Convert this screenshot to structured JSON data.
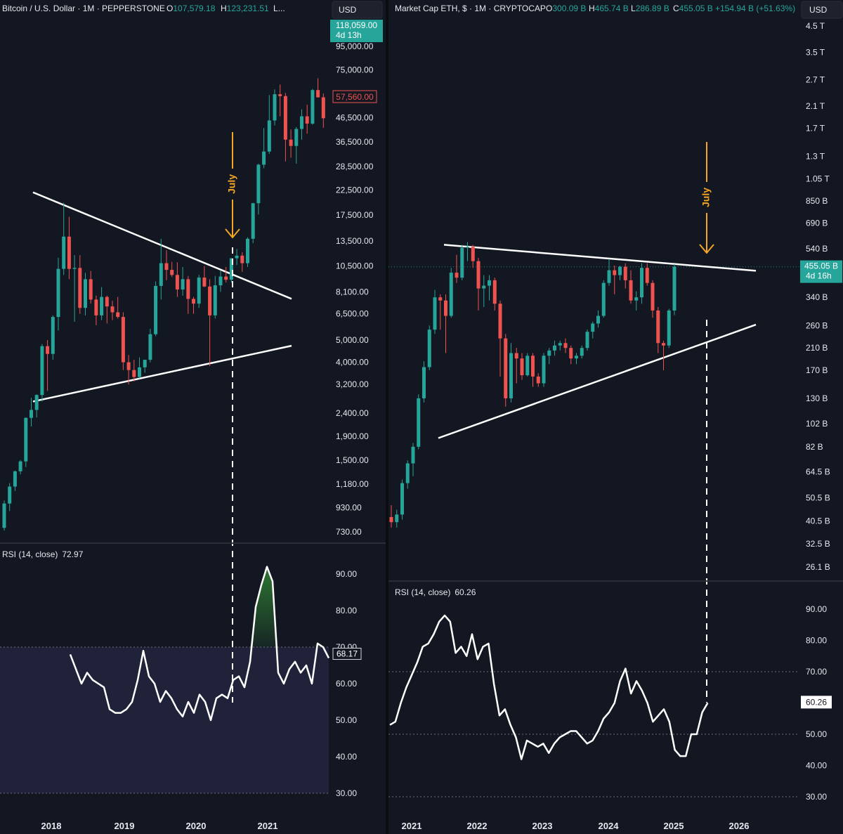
{
  "colors": {
    "background": "#131722",
    "up": "#26a69a",
    "down": "#ef5350",
    "trend_line": "#ffffff",
    "annotation": "#f5a623",
    "rsi_line": "#ffffff",
    "rsi_band": "#2a2c4d",
    "rsi_overbought_fill": "#2e7d32",
    "text": "#e6e8ef",
    "muted": "#8a8f9c"
  },
  "left": {
    "title": "Bitcoin / U.S. Dollar · 1M · PEPPERSTONE",
    "ohlc": [
      {
        "k": "O",
        "v": "107,579.18"
      },
      {
        "k": "H",
        "v": "123,231.51"
      },
      {
        "k": "L",
        "v": "..."
      }
    ],
    "currency_button": "USD",
    "price_axis_labels": [
      "95,000.00",
      "75,000.00",
      "46,500.00",
      "36,500.00",
      "28,500.00",
      "22,500.00",
      "17,500.00",
      "13,500.00",
      "10,500.00",
      "8,100.00",
      "6,500.00",
      "5,000.00",
      "4,000.00",
      "3,200.00",
      "2,400.00",
      "1,900.00",
      "1,500.00",
      "1,180.00",
      "930.00",
      "730.00"
    ],
    "last_price_tag": {
      "price": "118,059.00",
      "countdown": "4d 13h"
    },
    "marker_tag": "57,560.00",
    "annotation": "July",
    "rsi": {
      "title": "RSI (14, close)",
      "value": "72.97",
      "tag": "68.17",
      "axis_labels": [
        "90.00",
        "80.00",
        "70.00",
        "60.00",
        "50.00",
        "40.00",
        "30.00"
      ]
    },
    "x_axis_labels": [
      "2018",
      "2019",
      "2020",
      "2021"
    ]
  },
  "right": {
    "title": "Market Cap ETH, $ · 1M · CRYPTOCAP",
    "ohlc": [
      {
        "k": "O",
        "v": "300.09 B"
      },
      {
        "k": "H",
        "v": "465.74 B"
      },
      {
        "k": "L",
        "v": "286.89 B"
      },
      {
        "k": "C",
        "v": "455.05 B"
      }
    ],
    "change": "+154.94 B (+51.63%)",
    "currency_button": "USD",
    "price_axis_labels": [
      "4.5 T",
      "3.5 T",
      "2.7 T",
      "2.1 T",
      "1.7 T",
      "1.3 T",
      "1.05 T",
      "850 B",
      "690 B",
      "540 B",
      "340 B",
      "260 B",
      "210 B",
      "170 B",
      "130 B",
      "102 B",
      "82 B",
      "64.5 B",
      "50.5 B",
      "40.5 B",
      "32.5 B",
      "26.1 B"
    ],
    "last_price_tag": {
      "price": "455.05 B",
      "countdown": "4d 16h"
    },
    "annotation": "July",
    "rsi": {
      "title": "RSI (14, close)",
      "value": "60.26",
      "tag": "60.26",
      "axis_labels": [
        "90.00",
        "80.00",
        "70.00",
        "60.00",
        "50.00",
        "40.00",
        "30.00"
      ]
    },
    "x_axis_labels": [
      "2021",
      "2022",
      "2023",
      "2024",
      "2025",
      "2026"
    ]
  },
  "chart_data": [
    {
      "type": "candlestick",
      "title": "Bitcoin / U.S. Dollar · 1M · PEPPERSTONE",
      "y_scale": "log",
      "ylim": [
        650,
        125000
      ],
      "x_ticks": [
        "2018",
        "2019",
        "2020",
        "2021"
      ],
      "candles": [
        {
          "o": 760,
          "h": 1000,
          "l": 740,
          "c": 970
        },
        {
          "o": 970,
          "h": 1190,
          "l": 900,
          "c": 1150
        },
        {
          "o": 1150,
          "h": 1350,
          "l": 1100,
          "c": 1340
        },
        {
          "o": 1340,
          "h": 1500,
          "l": 1300,
          "c": 1480
        },
        {
          "o": 1480,
          "h": 2300,
          "l": 1400,
          "c": 2290
        },
        {
          "o": 2290,
          "h": 2800,
          "l": 2100,
          "c": 2480
        },
        {
          "o": 2480,
          "h": 2900,
          "l": 2300,
          "c": 2880
        },
        {
          "o": 2880,
          "h": 4800,
          "l": 2700,
          "c": 4700
        },
        {
          "o": 4700,
          "h": 5000,
          "l": 3000,
          "c": 4350
        },
        {
          "o": 4350,
          "h": 6400,
          "l": 4100,
          "c": 6300
        },
        {
          "o": 6300,
          "h": 11400,
          "l": 5500,
          "c": 10200
        },
        {
          "o": 10200,
          "h": 19800,
          "l": 9600,
          "c": 14100
        },
        {
          "o": 14100,
          "h": 17200,
          "l": 9200,
          "c": 10200
        },
        {
          "o": 10200,
          "h": 11700,
          "l": 6000,
          "c": 10300
        },
        {
          "o": 10300,
          "h": 11700,
          "l": 6500,
          "c": 6900
        },
        {
          "o": 6900,
          "h": 9800,
          "l": 6400,
          "c": 9200
        },
        {
          "o": 9200,
          "h": 10000,
          "l": 7200,
          "c": 7500
        },
        {
          "o": 7500,
          "h": 7800,
          "l": 5800,
          "c": 6400
        },
        {
          "o": 6400,
          "h": 8500,
          "l": 6100,
          "c": 7700
        },
        {
          "o": 7700,
          "h": 7800,
          "l": 5900,
          "c": 7000
        },
        {
          "o": 7000,
          "h": 7400,
          "l": 6100,
          "c": 6600
        },
        {
          "o": 6600,
          "h": 7700,
          "l": 6200,
          "c": 6300
        },
        {
          "o": 6300,
          "h": 6600,
          "l": 3700,
          "c": 4000
        },
        {
          "o": 4000,
          "h": 4300,
          "l": 3200,
          "c": 3700
        },
        {
          "o": 3700,
          "h": 4100,
          "l": 3300,
          "c": 3450
        },
        {
          "o": 3450,
          "h": 4200,
          "l": 3400,
          "c": 3800
        },
        {
          "o": 3800,
          "h": 4100,
          "l": 3600,
          "c": 4100
        },
        {
          "o": 4100,
          "h": 5600,
          "l": 4000,
          "c": 5300
        },
        {
          "o": 5300,
          "h": 9000,
          "l": 5200,
          "c": 8600
        },
        {
          "o": 8600,
          "h": 13800,
          "l": 7500,
          "c": 10800
        },
        {
          "o": 10800,
          "h": 12300,
          "l": 9100,
          "c": 10100
        },
        {
          "o": 10100,
          "h": 10950,
          "l": 9400,
          "c": 9600
        },
        {
          "o": 9600,
          "h": 10900,
          "l": 7700,
          "c": 8300
        },
        {
          "o": 8300,
          "h": 10400,
          "l": 7800,
          "c": 9200
        },
        {
          "o": 9200,
          "h": 9500,
          "l": 6500,
          "c": 7550
        },
        {
          "o": 7550,
          "h": 7700,
          "l": 6500,
          "c": 7200
        },
        {
          "o": 7200,
          "h": 9600,
          "l": 6900,
          "c": 9350
        },
        {
          "o": 9350,
          "h": 10500,
          "l": 8500,
          "c": 8550
        },
        {
          "o": 8550,
          "h": 9200,
          "l": 3850,
          "c": 6400
        },
        {
          "o": 6400,
          "h": 9500,
          "l": 6200,
          "c": 8650
        },
        {
          "o": 8650,
          "h": 10000,
          "l": 8100,
          "c": 9450
        },
        {
          "o": 9450,
          "h": 10400,
          "l": 8900,
          "c": 9150
        },
        {
          "o": 9150,
          "h": 9850,
          "l": 8900,
          "c": 11350
        },
        {
          "o": 11350,
          "h": 12450,
          "l": 10600,
          "c": 11650
        },
        {
          "o": 11650,
          "h": 12050,
          "l": 9900,
          "c": 10800
        },
        {
          "o": 10800,
          "h": 14000,
          "l": 10400,
          "c": 13800
        },
        {
          "o": 13800,
          "h": 19800,
          "l": 13200,
          "c": 19700
        },
        {
          "o": 19700,
          "h": 29300,
          "l": 17600,
          "c": 29000
        },
        {
          "o": 29000,
          "h": 41900,
          "l": 28000,
          "c": 33100
        },
        {
          "o": 33100,
          "h": 58300,
          "l": 32300,
          "c": 45200
        },
        {
          "o": 45200,
          "h": 61700,
          "l": 43000,
          "c": 58800
        },
        {
          "o": 58800,
          "h": 64800,
          "l": 47100,
          "c": 57700
        },
        {
          "o": 57700,
          "h": 59500,
          "l": 30000,
          "c": 37300
        },
        {
          "o": 37300,
          "h": 41300,
          "l": 31100,
          "c": 35000
        },
        {
          "o": 35000,
          "h": 42300,
          "l": 29300,
          "c": 41500
        },
        {
          "o": 41500,
          "h": 50500,
          "l": 37300,
          "c": 47100
        },
        {
          "o": 47100,
          "h": 52900,
          "l": 39600,
          "c": 43800
        },
        {
          "o": 43800,
          "h": 62000,
          "l": 43300,
          "c": 61300
        },
        {
          "o": 61300,
          "h": 69000,
          "l": 56800,
          "c": 57000
        },
        {
          "o": 57000,
          "h": 59200,
          "l": 42000,
          "c": 46200
        }
      ],
      "trendlines": [
        {
          "from": {
            "index": 10,
            "price": 19800
          },
          "to": {
            "index": 50,
            "price": 8100
          }
        },
        {
          "from": {
            "index": 10,
            "price": 2850
          },
          "to": {
            "index": 50,
            "price": 4550
          }
        }
      ],
      "annotation": {
        "text": "July",
        "index": 42
      },
      "rsi": {
        "name": "RSI (14, close)",
        "ylim": [
          30,
          90
        ],
        "band": [
          30,
          70
        ],
        "values": [
          68,
          64,
          60,
          63,
          61,
          60,
          59,
          53,
          52,
          52,
          53,
          55,
          61,
          69,
          62,
          60,
          55,
          58,
          56,
          53,
          51,
          55,
          52,
          57,
          55,
          50,
          56,
          57,
          56,
          61,
          62,
          59,
          66,
          81,
          87,
          92,
          88,
          63,
          60,
          64,
          66,
          63,
          65,
          60,
          71,
          70,
          67
        ]
      }
    },
    {
      "type": "candlestick",
      "title": "Market Cap ETH, $ · 1M · CRYPTOCAP",
      "y_scale": "log",
      "ylim": [
        24,
        5000
      ],
      "x_ticks": [
        "2021",
        "2022",
        "2023",
        "2024",
        "2025",
        "2026"
      ],
      "candles": [
        {
          "o": 42,
          "h": 47,
          "l": 38,
          "c": 40
        },
        {
          "o": 40,
          "h": 45,
          "l": 38,
          "c": 43
        },
        {
          "o": 43,
          "h": 60,
          "l": 41,
          "c": 58
        },
        {
          "o": 58,
          "h": 72,
          "l": 55,
          "c": 70
        },
        {
          "o": 70,
          "h": 85,
          "l": 62,
          "c": 82
        },
        {
          "o": 82,
          "h": 135,
          "l": 80,
          "c": 130
        },
        {
          "o": 130,
          "h": 185,
          "l": 125,
          "c": 175
        },
        {
          "o": 175,
          "h": 260,
          "l": 170,
          "c": 250
        },
        {
          "o": 250,
          "h": 365,
          "l": 240,
          "c": 340
        },
        {
          "o": 340,
          "h": 350,
          "l": 250,
          "c": 330
        },
        {
          "o": 330,
          "h": 350,
          "l": 200,
          "c": 285
        },
        {
          "o": 285,
          "h": 450,
          "l": 280,
          "c": 430
        },
        {
          "o": 430,
          "h": 510,
          "l": 390,
          "c": 410
        },
        {
          "o": 410,
          "h": 560,
          "l": 400,
          "c": 545
        },
        {
          "o": 545,
          "h": 575,
          "l": 480,
          "c": 550
        },
        {
          "o": 550,
          "h": 560,
          "l": 450,
          "c": 480
        },
        {
          "o": 480,
          "h": 495,
          "l": 300,
          "c": 370
        },
        {
          "o": 370,
          "h": 420,
          "l": 310,
          "c": 380
        },
        {
          "o": 380,
          "h": 420,
          "l": 330,
          "c": 400
        },
        {
          "o": 400,
          "h": 410,
          "l": 300,
          "c": 320
        },
        {
          "o": 320,
          "h": 330,
          "l": 160,
          "c": 230
        },
        {
          "o": 230,
          "h": 240,
          "l": 120,
          "c": 130
        },
        {
          "o": 130,
          "h": 220,
          "l": 125,
          "c": 200
        },
        {
          "o": 200,
          "h": 210,
          "l": 150,
          "c": 190
        },
        {
          "o": 190,
          "h": 200,
          "l": 155,
          "c": 162
        },
        {
          "o": 162,
          "h": 200,
          "l": 160,
          "c": 195
        },
        {
          "o": 195,
          "h": 200,
          "l": 145,
          "c": 160
        },
        {
          "o": 160,
          "h": 165,
          "l": 145,
          "c": 150
        },
        {
          "o": 150,
          "h": 200,
          "l": 145,
          "c": 195
        },
        {
          "o": 195,
          "h": 210,
          "l": 180,
          "c": 205
        },
        {
          "o": 205,
          "h": 225,
          "l": 195,
          "c": 215
        },
        {
          "o": 215,
          "h": 225,
          "l": 205,
          "c": 220
        },
        {
          "o": 220,
          "h": 230,
          "l": 200,
          "c": 210
        },
        {
          "o": 210,
          "h": 215,
          "l": 180,
          "c": 190
        },
        {
          "o": 190,
          "h": 200,
          "l": 180,
          "c": 195
        },
        {
          "o": 195,
          "h": 215,
          "l": 190,
          "c": 210
        },
        {
          "o": 210,
          "h": 250,
          "l": 205,
          "c": 245
        },
        {
          "o": 245,
          "h": 270,
          "l": 230,
          "c": 265
        },
        {
          "o": 265,
          "h": 300,
          "l": 255,
          "c": 285
        },
        {
          "o": 285,
          "h": 400,
          "l": 280,
          "c": 390
        },
        {
          "o": 390,
          "h": 490,
          "l": 380,
          "c": 440
        },
        {
          "o": 440,
          "h": 460,
          "l": 350,
          "c": 420
        },
        {
          "o": 420,
          "h": 460,
          "l": 400,
          "c": 455
        },
        {
          "o": 455,
          "h": 470,
          "l": 370,
          "c": 400
        },
        {
          "o": 400,
          "h": 440,
          "l": 320,
          "c": 330
        },
        {
          "o": 330,
          "h": 360,
          "l": 300,
          "c": 340
        },
        {
          "o": 340,
          "h": 470,
          "l": 320,
          "c": 450
        },
        {
          "o": 450,
          "h": 470,
          "l": 380,
          "c": 390
        },
        {
          "o": 390,
          "h": 400,
          "l": 280,
          "c": 300
        },
        {
          "o": 300,
          "h": 310,
          "l": 200,
          "c": 220
        },
        {
          "o": 220,
          "h": 225,
          "l": 170,
          "c": 215
        },
        {
          "o": 215,
          "h": 305,
          "l": 210,
          "c": 300
        },
        {
          "o": 300,
          "h": 466,
          "l": 287,
          "c": 455
        }
      ],
      "trendlines": [
        {
          "from": {
            "index": 8,
            "price": 565
          },
          "to": {
            "index": 58,
            "price": 455
          }
        },
        {
          "from": {
            "index": 8,
            "price": 88
          },
          "to": {
            "index": 58,
            "price": 222
          }
        }
      ],
      "annotation": {
        "text": "July",
        "index": 50
      },
      "rsi": {
        "name": "RSI (14, close)",
        "ylim": [
          30,
          90
        ],
        "band": [
          50,
          70
        ],
        "values": [
          53,
          54,
          60,
          65,
          69,
          73,
          78,
          79,
          82,
          86,
          88,
          86,
          76,
          78,
          75,
          82,
          74,
          78,
          79,
          66,
          56,
          58,
          53,
          49,
          42,
          48,
          47,
          46,
          47,
          44,
          47,
          49,
          50,
          51,
          51,
          49,
          47,
          48,
          51,
          55,
          57,
          60,
          67,
          71,
          63,
          67,
          64,
          60,
          54,
          56,
          58,
          54,
          45,
          43,
          43,
          50,
          50,
          57,
          60
        ]
      }
    }
  ]
}
